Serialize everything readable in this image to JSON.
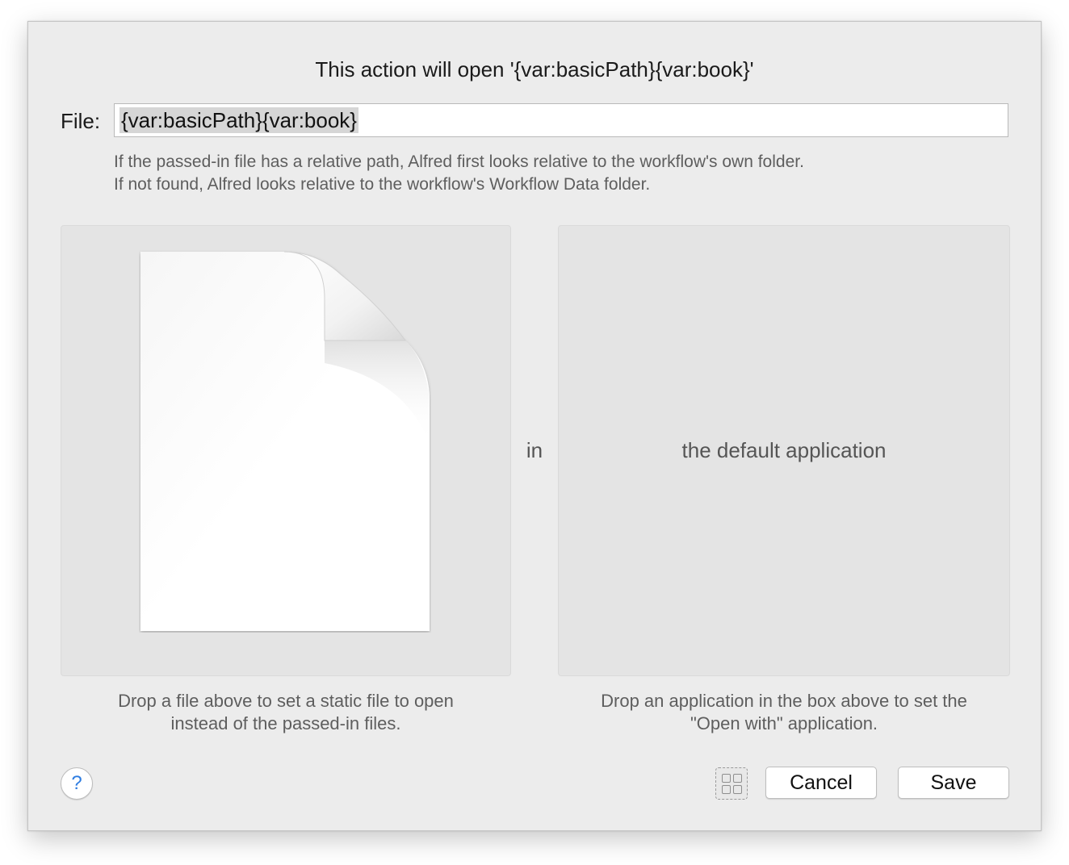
{
  "dialog": {
    "title": "This action will open '{var:basicPath}{var:book}'",
    "file_label": "File:",
    "file_value": "{var:basicPath}{var:book}",
    "hint_line1": "If the passed-in file has a relative path, Alfred first looks relative to the workflow's own folder.",
    "hint_line2": "If not found, Alfred looks relative to the workflow's Workflow Data folder.",
    "connector": "in",
    "default_app_label": "the default application",
    "file_drop_caption_line1": "Drop a file above to set a static file to open",
    "file_drop_caption_line2": "instead of the passed-in files.",
    "app_drop_caption_line1": "Drop an application in the box above to set the",
    "app_drop_caption_line2": "\"Open with\" application."
  },
  "footer": {
    "help_label": "?",
    "cancel_label": "Cancel",
    "save_label": "Save"
  },
  "icons": {
    "help": "question-mark-icon",
    "grid": "grid-icon",
    "document": "blank-document-icon"
  }
}
